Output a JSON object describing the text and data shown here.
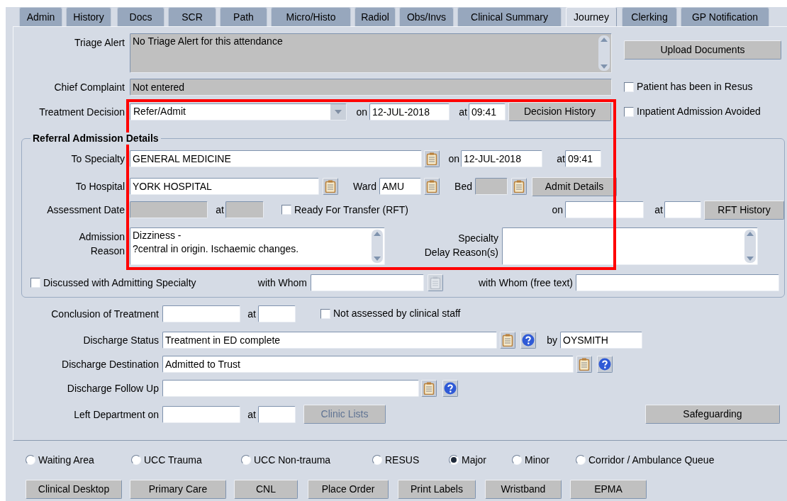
{
  "tabs": [
    {
      "label": "Admin",
      "selected": false
    },
    {
      "label": "History",
      "selected": false
    },
    {
      "label": "Docs",
      "selected": false
    },
    {
      "label": "SCR",
      "selected": false
    },
    {
      "label": "Path",
      "selected": false
    },
    {
      "label": "Micro/Histo",
      "selected": false
    },
    {
      "label": "Radiol",
      "selected": false
    },
    {
      "label": "Obs/Invs",
      "selected": false
    },
    {
      "label": "Clinical Summary",
      "selected": false
    },
    {
      "label": "Journey",
      "selected": true
    },
    {
      "label": "Clerking",
      "selected": false
    },
    {
      "label": "GP Notification",
      "selected": false
    }
  ],
  "main_rows": [
    {
      "items": [
        {
          "kind": "label",
          "text": "Triage Alert"
        },
        {
          "kind": "textarea",
          "value": "No Triage Alert for this attendance",
          "readonly": true
        },
        {
          "kind": "button",
          "label": "Upload Documents",
          "disabled": false
        }
      ]
    },
    {
      "items": [
        {
          "kind": "label",
          "text": "Chief Complaint"
        },
        {
          "kind": "field",
          "value": "Not entered",
          "readonly": true
        },
        {
          "kind": "checkbox",
          "label": "Patient has been in Resus",
          "checked": false
        }
      ]
    },
    {
      "items": [
        {
          "kind": "label",
          "text": "Treatment Decision"
        },
        {
          "kind": "select",
          "value": "Refer/Admit"
        },
        {
          "kind": "label",
          "text": "on"
        },
        {
          "kind": "field",
          "value": "12-JUL-2018",
          "readonly": false
        },
        {
          "kind": "label",
          "text": "at"
        },
        {
          "kind": "field",
          "value": "09:41",
          "readonly": false
        },
        {
          "kind": "button",
          "label": "Decision History",
          "disabled": false
        },
        {
          "kind": "checkbox",
          "label": "Inpatient Admission Avoided",
          "checked": false
        }
      ]
    }
  ],
  "referral_section": {
    "title": "Referral Admission Details",
    "rows": [
      {
        "items": [
          {
            "kind": "label",
            "text": "To Specialty"
          },
          {
            "kind": "field",
            "value": "GENERAL MEDICINE",
            "readonly": false
          },
          {
            "kind": "lov",
            "disabled": false
          },
          {
            "kind": "label",
            "text": "on"
          },
          {
            "kind": "field",
            "value": "12-JUL-2018",
            "readonly": false
          },
          {
            "kind": "label",
            "text": "at"
          },
          {
            "kind": "field",
            "value": "09:41",
            "readonly": false
          }
        ]
      },
      {
        "items": [
          {
            "kind": "label",
            "text": "To Hospital"
          },
          {
            "kind": "field",
            "value": "YORK HOSPITAL",
            "readonly": false
          },
          {
            "kind": "lov",
            "disabled": false
          },
          {
            "kind": "label",
            "text": "Ward"
          },
          {
            "kind": "field",
            "value": "AMU",
            "readonly": false
          },
          {
            "kind": "lov",
            "disabled": false
          },
          {
            "kind": "label",
            "text": "Bed"
          },
          {
            "kind": "field",
            "readonly": true
          },
          {
            "kind": "lov",
            "disabled": false
          },
          {
            "kind": "button",
            "label": "Admit Details",
            "disabled": false
          }
        ]
      },
      {
        "items": [
          {
            "kind": "label",
            "text": "Assessment Date"
          },
          {
            "kind": "field",
            "readonly": true
          },
          {
            "kind": "label",
            "text": "at"
          },
          {
            "kind": "field",
            "readonly": true
          },
          {
            "kind": "checkbox",
            "label": "Ready For Transfer (RFT)",
            "checked": false
          },
          {
            "kind": "label",
            "text": "on"
          },
          {
            "kind": "field",
            "readonly": false
          },
          {
            "kind": "label",
            "text": "at"
          },
          {
            "kind": "field",
            "readonly": false
          },
          {
            "kind": "button",
            "label": "RFT History",
            "disabled": false
          }
        ]
      },
      {
        "items": [
          {
            "kind": "label",
            "text": "Admission\nReason"
          },
          {
            "kind": "textarea",
            "value": "Dizziness -\n?central in origin. Ischaemic changes.",
            "readonly": false
          },
          {
            "kind": "label",
            "text": "Specialty\nDelay Reason(s)"
          },
          {
            "kind": "textarea",
            "readonly": false
          }
        ]
      },
      {
        "items": [
          {
            "kind": "checkbox",
            "label": "Discussed with Admitting Specialty",
            "checked": false
          },
          {
            "kind": "label",
            "text": "with Whom"
          },
          {
            "kind": "field",
            "readonly": false
          },
          {
            "kind": "lov",
            "disabled": true
          },
          {
            "kind": "label",
            "text": "with Whom (free text)"
          },
          {
            "kind": "field",
            "readonly": false
          }
        ]
      }
    ]
  },
  "lower_rows": [
    {
      "items": [
        {
          "kind": "label",
          "text": "Conclusion of Treatment"
        },
        {
          "kind": "field",
          "readonly": false
        },
        {
          "kind": "label",
          "text": "at"
        },
        {
          "kind": "field",
          "readonly": false
        },
        {
          "kind": "checkbox",
          "label": "Not assessed by clinical staff",
          "checked": false
        }
      ]
    },
    {
      "items": [
        {
          "kind": "label",
          "text": "Discharge Status"
        },
        {
          "kind": "field",
          "value": "Treatment in ED complete",
          "readonly": false
        },
        {
          "kind": "lov",
          "disabled": false
        },
        {
          "kind": "help"
        },
        {
          "kind": "label",
          "text": "by"
        },
        {
          "kind": "field",
          "value": "OYSMITH",
          "readonly": false
        }
      ]
    },
    {
      "items": [
        {
          "kind": "label",
          "text": "Discharge Destination"
        },
        {
          "kind": "field",
          "value": "Admitted to Trust",
          "readonly": false
        },
        {
          "kind": "lov",
          "disabled": false
        },
        {
          "kind": "help"
        }
      ]
    },
    {
      "items": [
        {
          "kind": "label",
          "text": "Discharge Follow Up"
        },
        {
          "kind": "field",
          "readonly": false
        },
        {
          "kind": "lov",
          "disabled": false
        },
        {
          "kind": "help"
        }
      ]
    },
    {
      "items": [
        {
          "kind": "label",
          "text": "Left Department on"
        },
        {
          "kind": "field",
          "readonly": false
        },
        {
          "kind": "label",
          "text": "at"
        },
        {
          "kind": "field",
          "readonly": false
        },
        {
          "kind": "button",
          "label": "Clinic Lists",
          "disabled": true
        },
        {
          "kind": "button",
          "label": "Safeguarding",
          "disabled": false
        }
      ]
    }
  ],
  "location_options": [
    {
      "label": "Waiting Area",
      "selected": false
    },
    {
      "label": "UCC Trauma",
      "selected": false
    },
    {
      "label": "UCC Non-trauma",
      "selected": false
    },
    {
      "label": "RESUS",
      "selected": false
    },
    {
      "label": "Major",
      "selected": true
    },
    {
      "label": "Minor",
      "selected": false
    },
    {
      "label": "Corridor / Ambulance Queue",
      "selected": false
    }
  ],
  "bottom_buttons": [
    {
      "label": "Clinical Desktop"
    },
    {
      "label": "Primary Care"
    },
    {
      "label": "CNL"
    },
    {
      "label": "Place Order"
    },
    {
      "label": "Print Labels"
    },
    {
      "label": "Wristband"
    },
    {
      "label": "EPMA"
    }
  ],
  "annotation": {
    "kind": "outline"
  }
}
